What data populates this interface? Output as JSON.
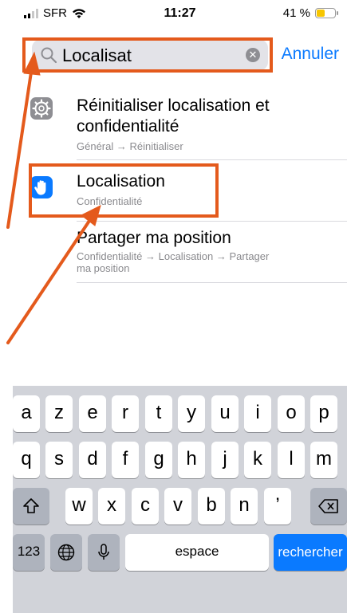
{
  "status": {
    "carrier": "SFR",
    "time": "11:27",
    "battery_text": "41 %",
    "battery_level": 0.41
  },
  "search": {
    "value": "Localisat",
    "cancel_label": "Annuler"
  },
  "results": [
    {
      "title_line1": "Réinitialiser localisation et",
      "title_line2": "confidentialité",
      "path": "Général → Réinitialiser",
      "icon": "gear-icon"
    },
    {
      "title": "Localisation",
      "path": "Confidentialité",
      "icon": "hand-icon"
    },
    {
      "title": "Partager ma position",
      "path_line1": "Confidentialité → Localisation → Partager",
      "path_line2": "ma position"
    }
  ],
  "keyboard": {
    "row1": [
      "a",
      "z",
      "e",
      "r",
      "t",
      "y",
      "u",
      "i",
      "o",
      "p"
    ],
    "row2": [
      "q",
      "s",
      "d",
      "f",
      "g",
      "h",
      "j",
      "k",
      "l",
      "m"
    ],
    "row3": [
      "w",
      "x",
      "c",
      "v",
      "b",
      "n",
      "’"
    ],
    "numbers_label": "123",
    "space_label": "espace",
    "search_label": "rechercher"
  },
  "colors": {
    "accent": "#0a7aff",
    "highlight": "#e45a1c"
  }
}
